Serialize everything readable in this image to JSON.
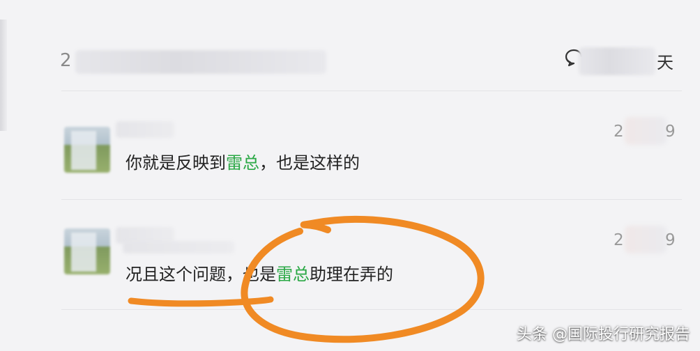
{
  "header": {
    "prefix_partial": "2",
    "suffix_partial": "天",
    "comment_icon": "comment-bubble-icon"
  },
  "comments": [
    {
      "time_partial_start": "2",
      "time_partial_end": "9",
      "text_before": "你就是反映到",
      "text_highlight": "雷总",
      "text_after": "，也是这样的"
    },
    {
      "time_partial_start": "2",
      "time_partial_end": "9",
      "text_before": "况且这个问题，也是",
      "text_highlight": "雷总",
      "text_after": "助理在弄的"
    }
  ],
  "annotation": {
    "color": "#f08a24",
    "shape": "hand-drawn-circle"
  },
  "colors": {
    "highlight": "#2aa845",
    "background": "#f3f3f5",
    "text": "#222222",
    "muted": "#999999"
  },
  "watermark": {
    "text": "头条 @国际投行研究报告"
  }
}
